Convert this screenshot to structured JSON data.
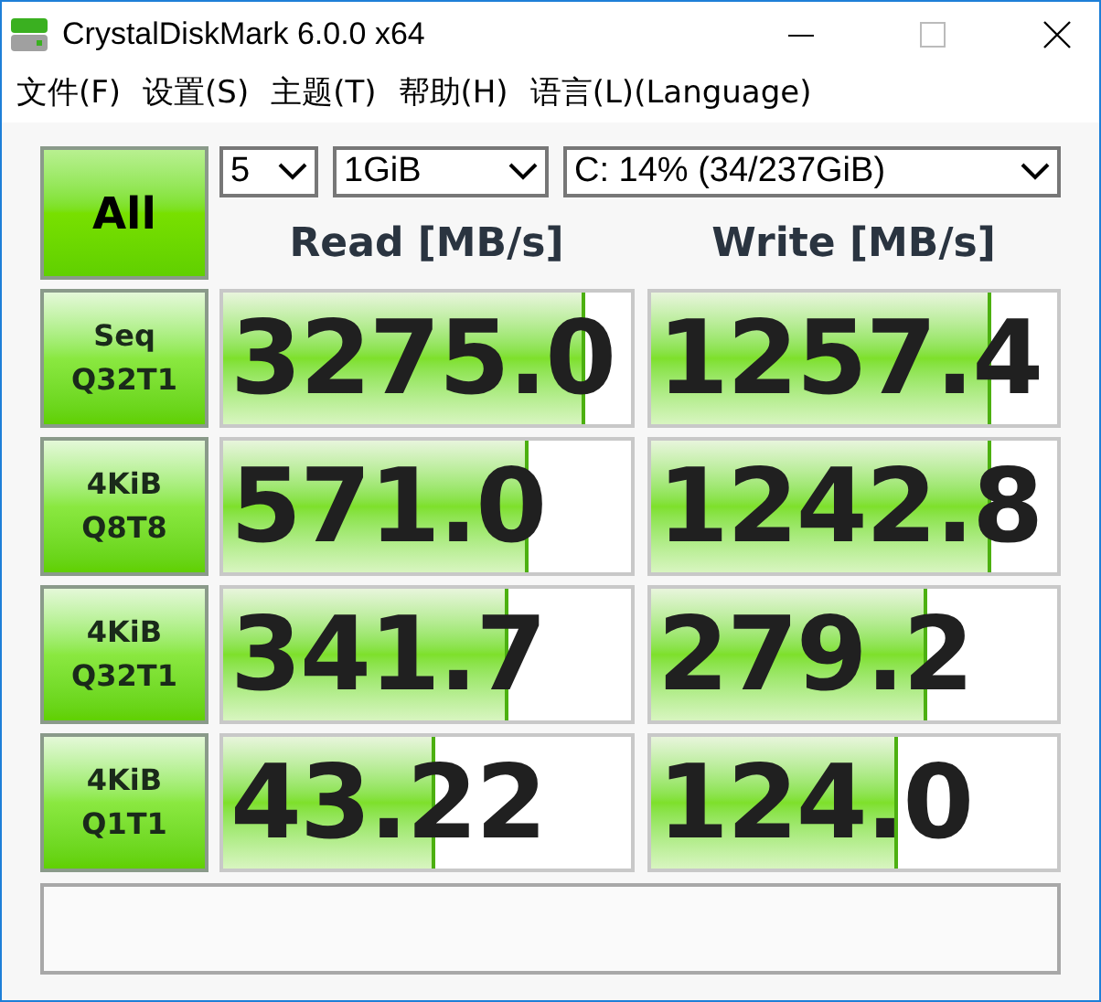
{
  "window": {
    "title": "CrystalDiskMark 6.0.0 x64"
  },
  "menu": [
    "文件(F)",
    "设置(S)",
    "主题(T)",
    "帮助(H)",
    "语言(L)(Language)"
  ],
  "all_button": "All",
  "selects": [
    {
      "kind": "count",
      "value": "5"
    },
    {
      "kind": "size",
      "value": "1GiB"
    },
    {
      "kind": "drive",
      "value": "C: 14% (34/237GiB)"
    }
  ],
  "headers": [
    "Read [MB/s]",
    "Write [MB/s]"
  ],
  "tests": [
    {
      "label_1": "Seq",
      "label_2": "Q32T1",
      "read": {
        "value": "3275.0",
        "level": 0.89
      },
      "write": {
        "value": "1257.4",
        "level": 0.84
      }
    },
    {
      "label_1": "4KiB",
      "label_2": "Q8T8",
      "read": {
        "value": "571.0",
        "level": 0.75
      },
      "write": {
        "value": "1242.8",
        "level": 0.84
      }
    },
    {
      "label_1": "4KiB",
      "label_2": "Q32T1",
      "read": {
        "value": "341.7",
        "level": 0.7
      },
      "write": {
        "value": "279.2",
        "level": 0.68
      }
    },
    {
      "label_1": "4KiB",
      "label_2": "Q1T1",
      "read": {
        "value": "43.22",
        "level": 0.52
      },
      "write": {
        "value": "124.0",
        "level": 0.61
      }
    }
  ]
}
